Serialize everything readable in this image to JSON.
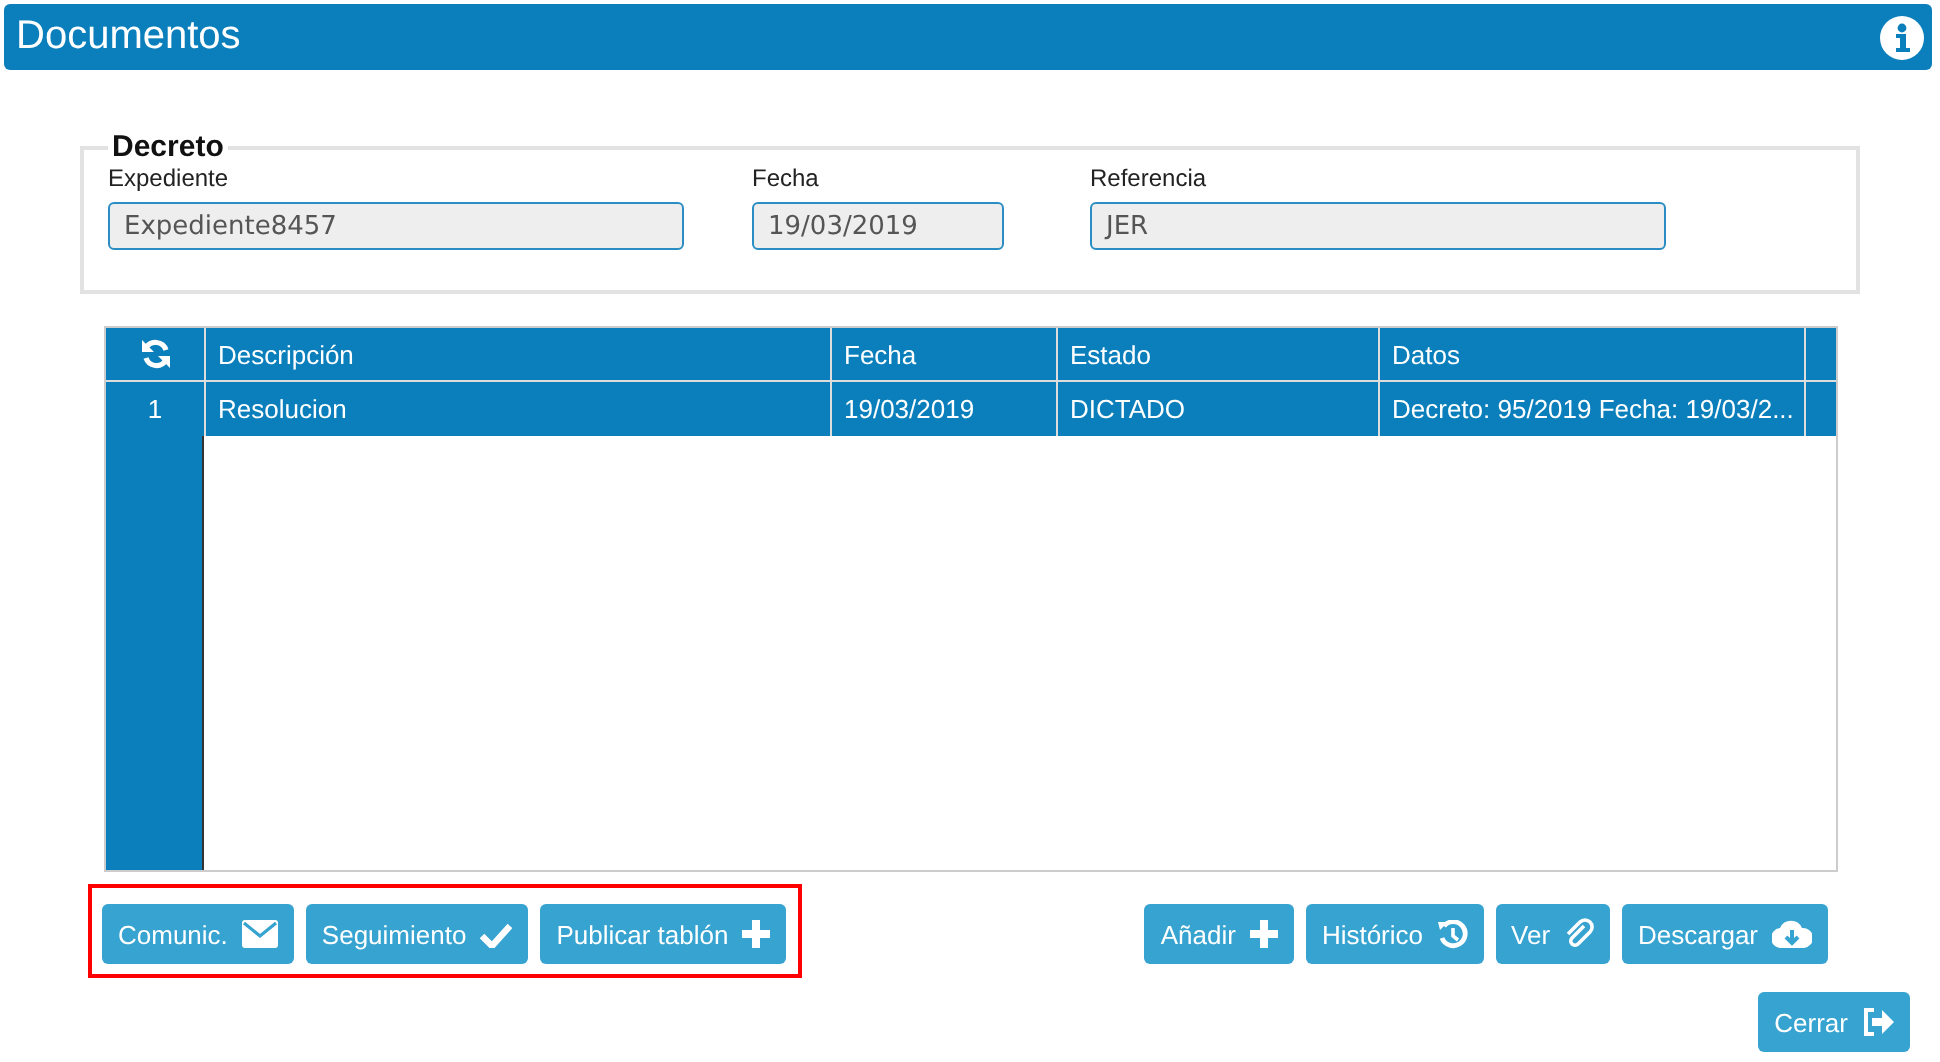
{
  "window": {
    "title": "Documentos"
  },
  "decreto": {
    "legend": "Decreto",
    "fields": [
      {
        "label": "Expediente",
        "value": "Expediente8457"
      },
      {
        "label": "Fecha",
        "value": "19/03/2019"
      },
      {
        "label": "Referencia",
        "value": "JER"
      }
    ]
  },
  "table": {
    "columns": [
      "Descripción",
      "Fecha",
      "Estado",
      "Datos"
    ],
    "rows": [
      {
        "number": "1",
        "cells": [
          "Resolucion",
          "19/03/2019",
          "DICTADO",
          "Decreto: 95/2019 Fecha: 19/03/2..."
        ],
        "selected": true
      }
    ]
  },
  "left_buttons": {
    "highlighted": true,
    "buttons": [
      "Comunic.",
      "Seguimiento",
      "Publicar tablón"
    ]
  },
  "right_buttons": [
    "Añadir",
    "Histórico",
    "Ver",
    "Descargar"
  ],
  "close_button": "Cerrar"
}
